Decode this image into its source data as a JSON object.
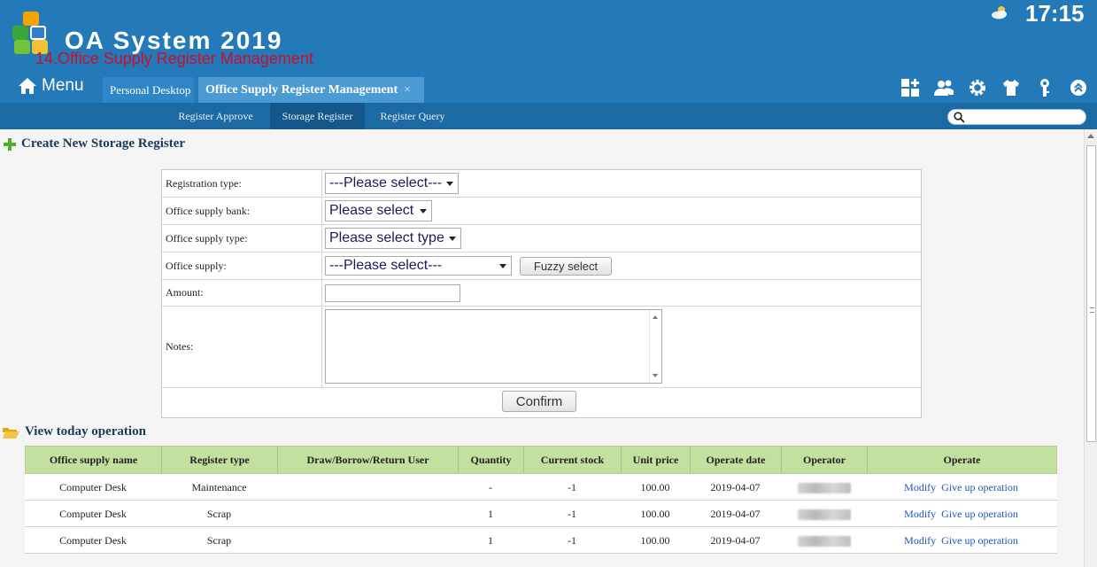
{
  "header": {
    "app_title": "OA System 2019",
    "subtitle": "14.Office Supply Register Management",
    "clock": "17:15",
    "weather_icon": "partly-cloudy-icon",
    "menu_label": "Menu"
  },
  "tabs": [
    {
      "label": "Personal Desktop",
      "active": false
    },
    {
      "label": "Office Supply Register Management",
      "active": true,
      "close": "×"
    }
  ],
  "toolbar_icons": [
    "grid-add-icon",
    "users-icon",
    "settings-icon",
    "shirt-icon",
    "key-icon",
    "collapse-up-icon"
  ],
  "subnav": {
    "items": [
      "Register Approve",
      "Storage Register",
      "Register Query"
    ],
    "active": "Storage Register",
    "search_placeholder": ""
  },
  "create_section": {
    "title": "Create New Storage Register",
    "fields": {
      "registration_type_label": "Registration type:",
      "registration_type_value": "---Please select---",
      "bank_label": "Office supply bank:",
      "bank_value": "Please select",
      "type_label": "Office supply type:",
      "type_value": "Please select type",
      "supply_label": "Office supply:",
      "supply_value": "---Please select---",
      "fuzzy_button": "Fuzzy select",
      "amount_label": "Amount:",
      "amount_value": "",
      "notes_label": "Notes:",
      "notes_value": ""
    },
    "confirm_button": "Confirm"
  },
  "view_section": {
    "title": "View today operation",
    "columns": [
      "Office supply name",
      "Register type",
      "Draw/Borrow/Return User",
      "Quantity",
      "Current stock",
      "Unit price",
      "Operate date",
      "Operator",
      "Operate"
    ],
    "rows": [
      {
        "name": "Computer Desk",
        "type": "Maintenance",
        "user": "",
        "quantity": "-",
        "stock": "-1",
        "price": "100.00",
        "date": "2019-04-07",
        "modify": "Modify",
        "give_up": "Give up operation"
      },
      {
        "name": "Computer Desk",
        "type": "Scrap",
        "user": "",
        "quantity": "1",
        "stock": "-1",
        "price": "100.00",
        "date": "2019-04-07",
        "modify": "Modify",
        "give_up": "Give up operation"
      },
      {
        "name": "Computer Desk",
        "type": "Scrap",
        "user": "",
        "quantity": "1",
        "stock": "-1",
        "price": "100.00",
        "date": "2019-04-07",
        "modify": "Modify",
        "give_up": "Give up operation"
      }
    ]
  },
  "colors": {
    "header_bg": "#2479b8",
    "subnav_bg": "#1c6aa4",
    "subtitle": "#c8102e",
    "table_header_bg": "#c4e0a0",
    "link": "#1f55b8"
  }
}
